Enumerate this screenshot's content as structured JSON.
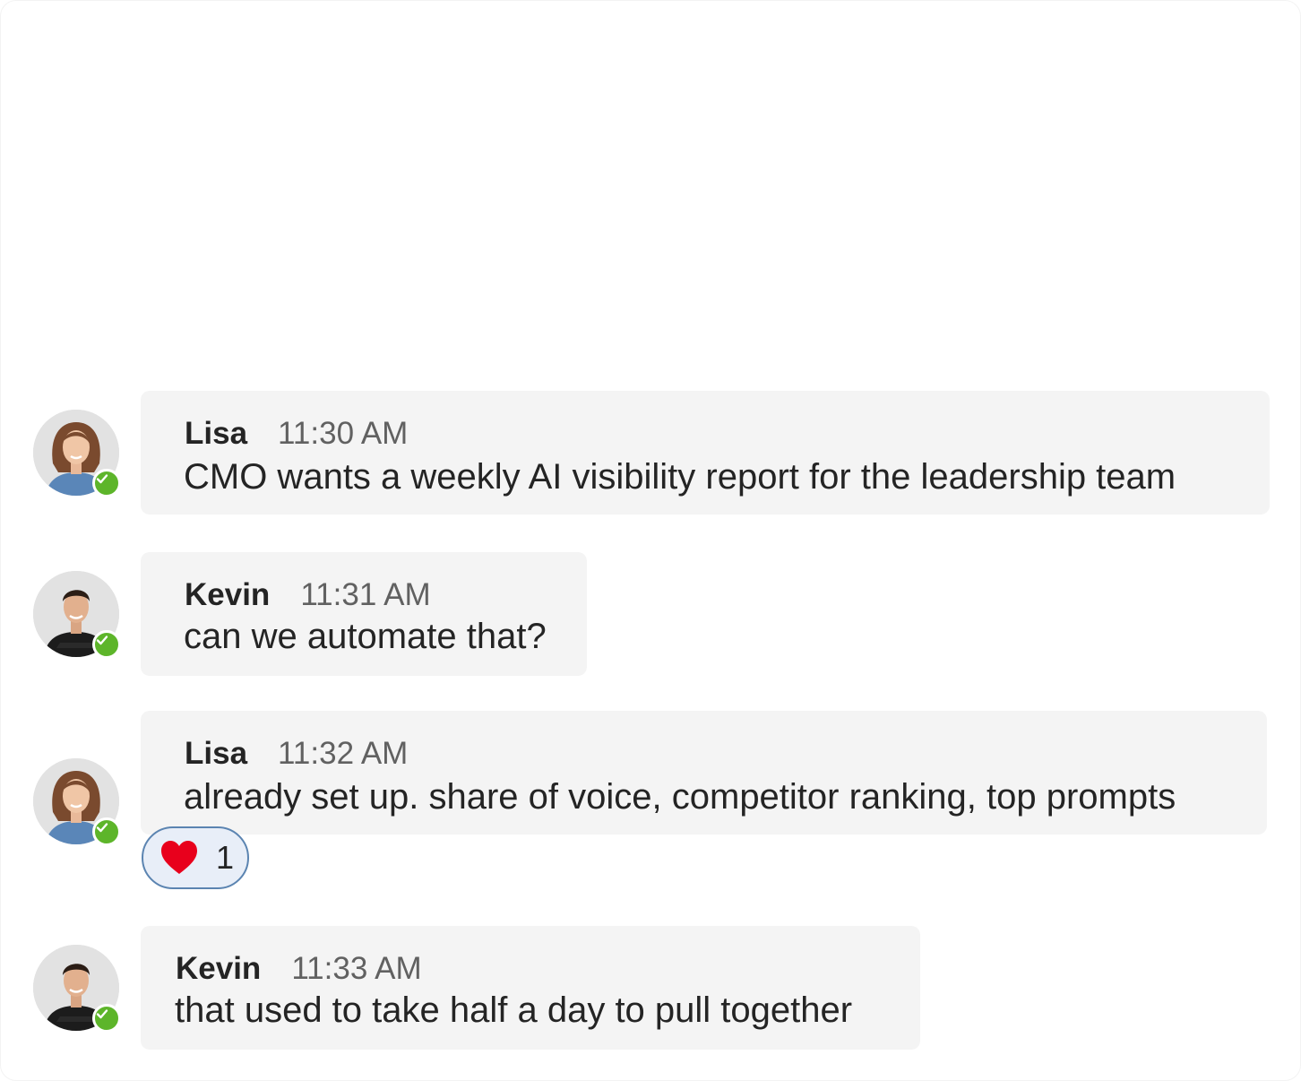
{
  "messages": [
    {
      "author": "Lisa",
      "time": "11:30 AM",
      "text": "CMO wants a weekly AI visibility report for the leadership team",
      "avatar": "woman-avatar",
      "status": "available"
    },
    {
      "author": "Kevin",
      "time": "11:31 AM",
      "text": "can we automate that?",
      "avatar": "man-avatar",
      "status": "available"
    },
    {
      "author": "Lisa",
      "time": "11:32 AM",
      "text": "already set up. share of voice, competitor ranking, top prompts",
      "avatar": "woman-avatar",
      "status": "available",
      "reaction": {
        "icon": "heart-icon",
        "count": "1"
      }
    },
    {
      "author": "Kevin",
      "time": "11:33 AM",
      "text": "that used to take half a day to pull together",
      "avatar": "man-avatar",
      "status": "available"
    }
  ],
  "colors": {
    "bubble": "#f4f4f4",
    "presence": "#5db52a",
    "reaction_border": "#5b84b1",
    "reaction_bg": "#e8eef8",
    "heart": "#e8001c"
  }
}
